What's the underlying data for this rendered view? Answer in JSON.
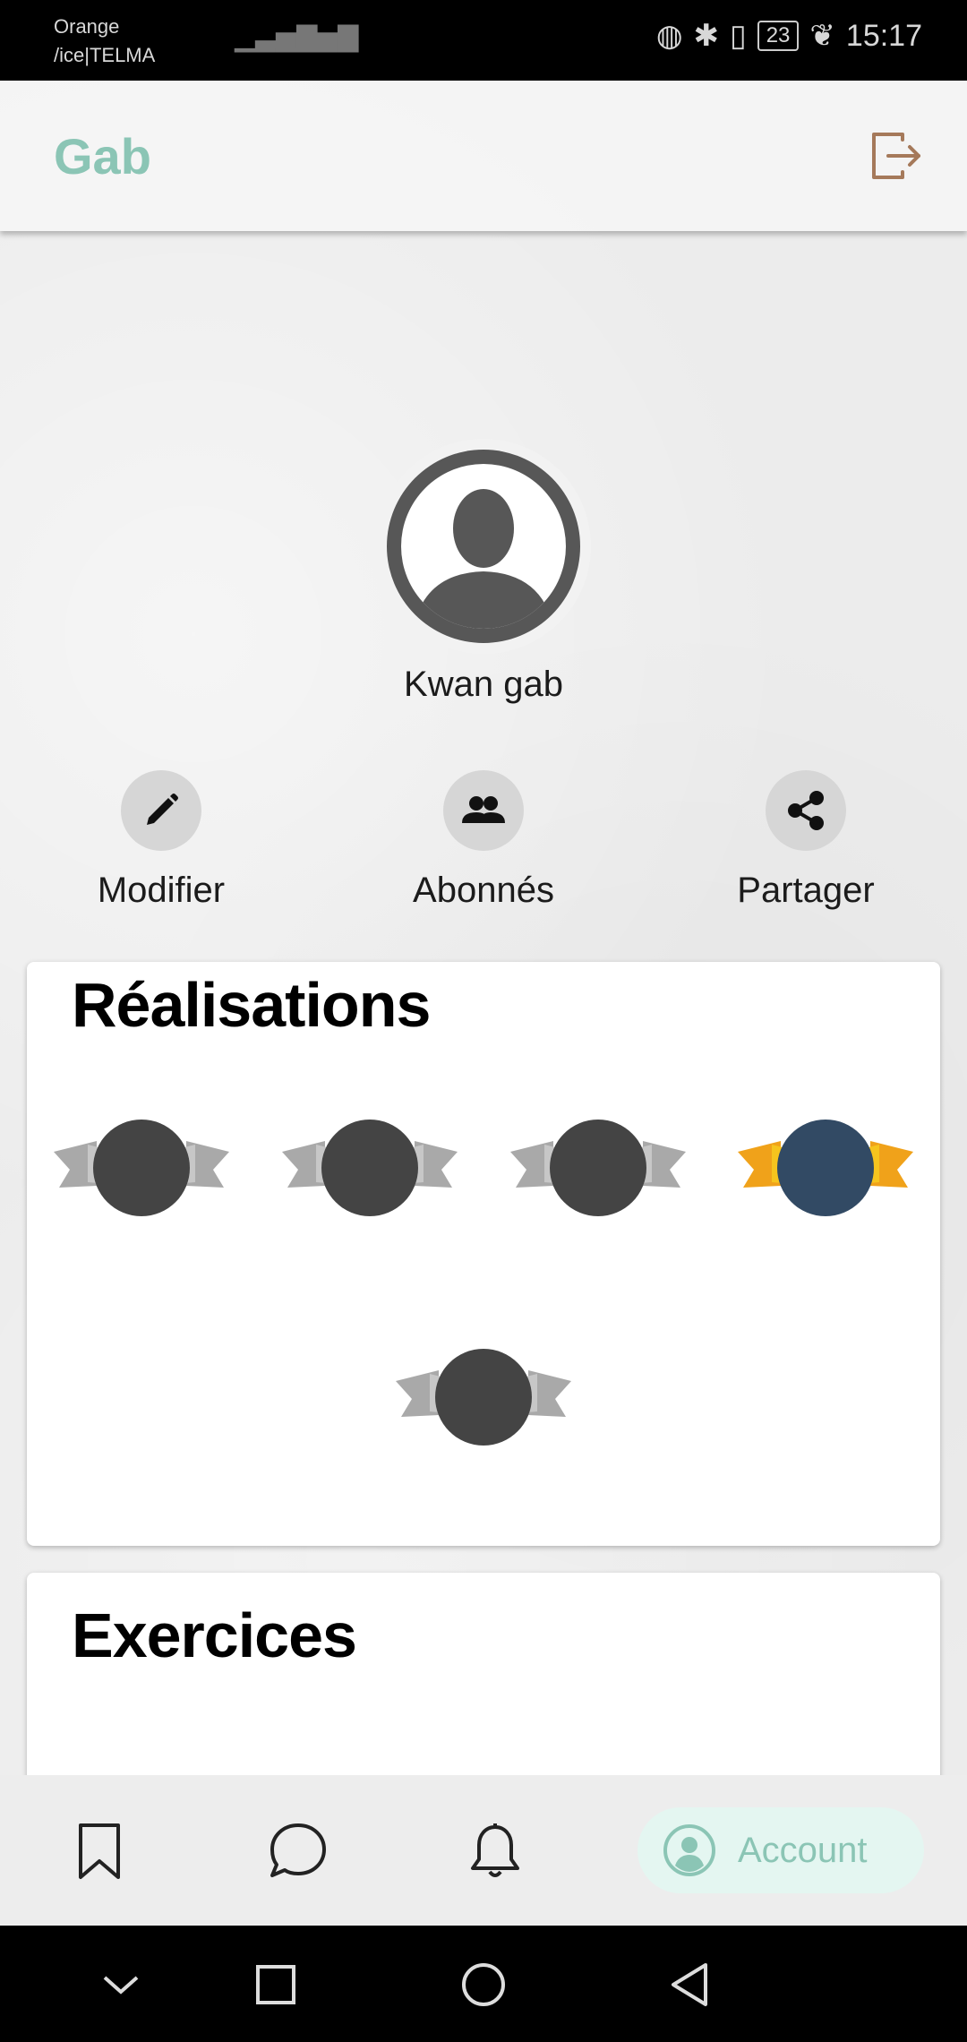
{
  "status_bar": {
    "carrier_line1": "Orange",
    "carrier_line2": "/ice|TELMA",
    "battery": "23",
    "time": "15:17"
  },
  "app_bar": {
    "title": "Gab",
    "logout_icon": "logout-icon"
  },
  "profile": {
    "name": "Kwan gab",
    "avatar_icon": "user-avatar-icon"
  },
  "actions": [
    {
      "label": "Modifier",
      "icon": "pencil-icon"
    },
    {
      "label": "Abonnés",
      "icon": "people-icon"
    },
    {
      "label": "Partager",
      "icon": "share-icon"
    }
  ],
  "achievements": {
    "title": "Réalisations",
    "medals": [
      {
        "state": "locked",
        "color": "#444444"
      },
      {
        "state": "locked",
        "color": "#444444"
      },
      {
        "state": "locked",
        "color": "#444444"
      },
      {
        "state": "unlocked",
        "color": "#324a64"
      },
      {
        "state": "locked",
        "color": "#444444"
      }
    ]
  },
  "exercises": {
    "title": "Exercices"
  },
  "bottom_nav": {
    "items": [
      {
        "icon": "bookmark-icon"
      },
      {
        "icon": "chat-icon"
      },
      {
        "icon": "bell-icon"
      },
      {
        "icon": "account-icon",
        "label": "Account",
        "active": true
      }
    ]
  },
  "colors": {
    "accent": "#8bc5b5",
    "logout": "#a5795a",
    "active_pill": "#e4f6f1"
  }
}
